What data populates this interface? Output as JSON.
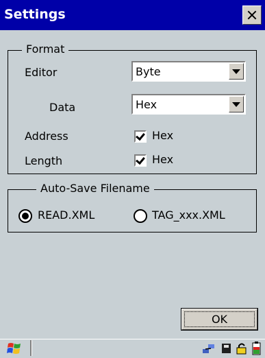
{
  "window": {
    "title": "Settings"
  },
  "format": {
    "legend": "Format",
    "editor": {
      "label": "Editor",
      "value": "Byte"
    },
    "data": {
      "label": "Data",
      "value": "Hex"
    },
    "address": {
      "label": "Address",
      "checkbox_label": "Hex",
      "checked": true
    },
    "length": {
      "label": "Length",
      "checkbox_label": "Hex",
      "checked": true
    }
  },
  "autosave": {
    "legend": "Auto-Save Filename",
    "options": [
      {
        "label": "READ.XML",
        "selected": true
      },
      {
        "label": "TAG_xxx.XML",
        "selected": false
      }
    ]
  },
  "buttons": {
    "ok": "OK"
  },
  "taskbar": {
    "icons": [
      "windows-start-icon",
      "network-icon",
      "storage-card-icon",
      "lock-icon",
      "battery-icon"
    ]
  },
  "colors": {
    "title_bar": "#0000a8",
    "background": "#c8d0d4"
  }
}
